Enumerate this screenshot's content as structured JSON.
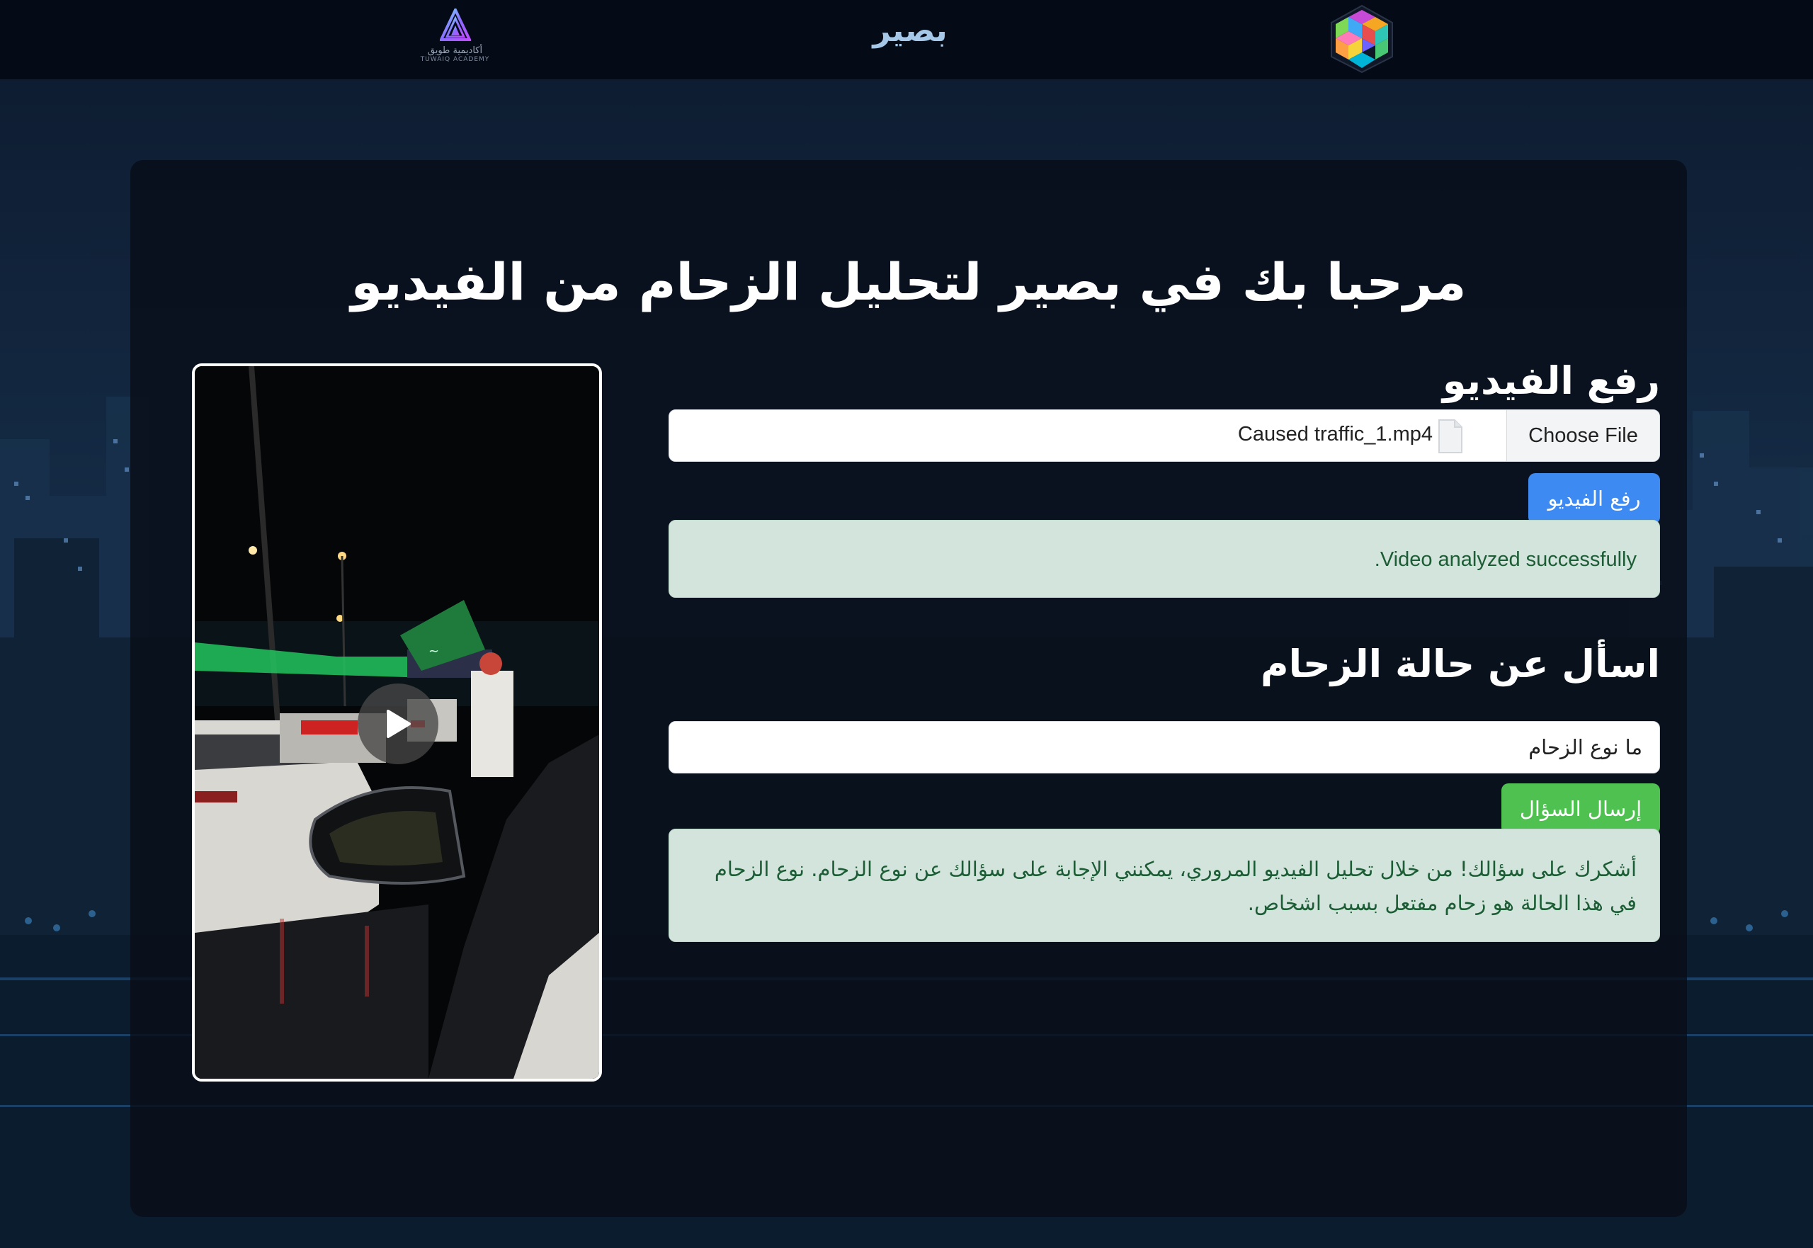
{
  "header": {
    "brand_title": "بصير",
    "left_logo_text_ar": "أكاديمية طويق",
    "left_logo_text_en": "TUWAIQ ACADEMY",
    "left_logo_icon": "tuwaiq-academy-logo",
    "right_logo_icon": "hexagon-cube-logo"
  },
  "main": {
    "title": "مرحبا بك في بصير لتحليل الزحام من الفيديو",
    "upload": {
      "heading": "رفع الفيديو",
      "choose_label": "Choose File",
      "file_name": "Caused traffic_1.mp4",
      "upload_button": "رفع الفيديو",
      "status_message": "Video analyzed successfully."
    },
    "ask": {
      "heading": "اسأل عن حالة الزحام",
      "question_value": "ما نوع الزحام",
      "send_button": "إرسال السؤال",
      "answer": "أشكرك على سؤالك! من خلال تحليل الفيديو المروري، يمكنني الإجابة على سؤالك عن نوع الزحام. نوع الزحام في هذا الحالة هو زحام مفتعل بسبب اشخاص."
    },
    "video": {
      "play_icon": "play-icon"
    }
  },
  "colors": {
    "primary_button": "#3d8bf2",
    "success_button": "#4fc150",
    "alert_bg": "#d2e4dc",
    "alert_text": "#1c5d35"
  }
}
